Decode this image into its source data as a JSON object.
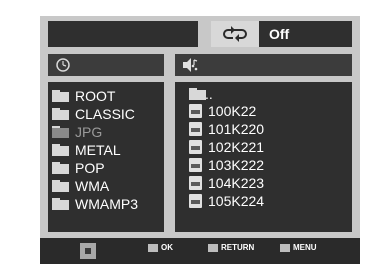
{
  "header": {
    "repeat_icon": "repeat-icon",
    "repeat_value": "Off"
  },
  "left_bar": {
    "icon": "disc-clock-icon"
  },
  "right_bar": {
    "icon": "speaker-music-icon"
  },
  "folders": [
    {
      "label": "ROOT",
      "selected": false
    },
    {
      "label": "CLASSIC",
      "selected": false
    },
    {
      "label": "JPG",
      "selected": true
    },
    {
      "label": "METAL",
      "selected": false
    },
    {
      "label": "POP",
      "selected": false
    },
    {
      "label": "WMA",
      "selected": false
    },
    {
      "label": "WMAMP3",
      "selected": false
    }
  ],
  "files": [
    {
      "label": "..",
      "icon": "folder-icon"
    },
    {
      "label": "100K22",
      "icon": "file-icon"
    },
    {
      "label": "101K220",
      "icon": "file-icon"
    },
    {
      "label": "102K221",
      "icon": "file-icon"
    },
    {
      "label": "103K222",
      "icon": "file-icon"
    },
    {
      "label": "104K223",
      "icon": "file-icon"
    },
    {
      "label": "105K224",
      "icon": "file-icon"
    }
  ],
  "footer": {
    "nav_icon": "navigation-pad-icon",
    "ok_label": "OK",
    "return_label": "RETURN",
    "menu_label": "MENU"
  }
}
